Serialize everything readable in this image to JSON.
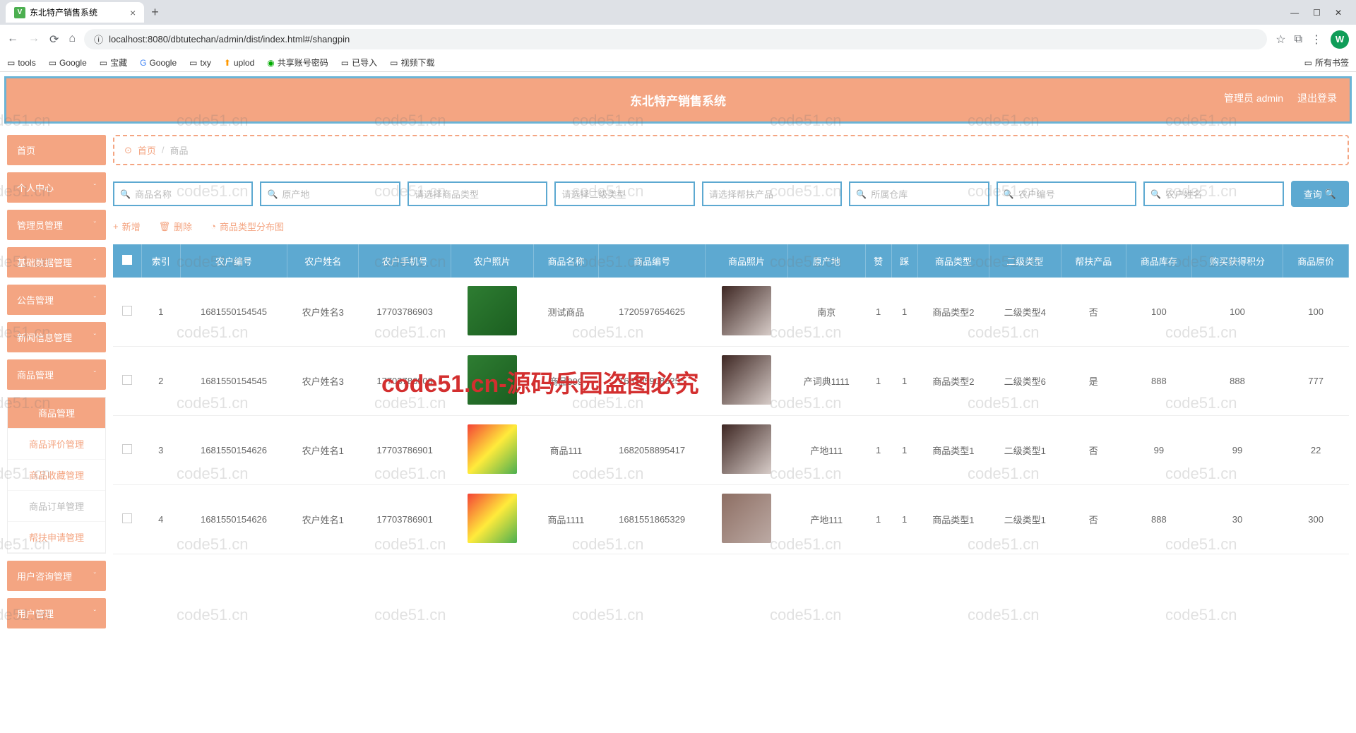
{
  "browser": {
    "tab_title": "东北特产销售系统",
    "url": "localhost:8080/dbtutechan/admin/dist/index.html#/shangpin",
    "bookmarks": [
      "tools",
      "Google",
      "宝藏",
      "Google",
      "txy",
      "uplod",
      "共享账号密码",
      "已导入",
      "视频下载"
    ],
    "bookmark_right": "所有书签",
    "avatar_letter": "W"
  },
  "header": {
    "title": "东北特产销售系统",
    "user": "管理员 admin",
    "logout": "退出登录"
  },
  "breadcrumb": {
    "home": "首页",
    "current": "商品"
  },
  "sidebar": {
    "items": [
      "首页",
      "个人中心",
      "管理员管理",
      "基础数据管理",
      "公告管理",
      "新闻信息管理",
      "商品管理"
    ],
    "sub": [
      "商品管理",
      "商品评价管理",
      "商品收藏管理",
      "商品订单管理",
      "帮扶申请管理"
    ],
    "items2": [
      "用户咨询管理",
      "用户管理"
    ]
  },
  "search": {
    "ph1": "商品名称",
    "ph2": "原产地",
    "ph3": "请选择商品类型",
    "ph4": "请选择二级类型",
    "ph5": "请选择帮扶产品",
    "ph6": "所属仓库",
    "ph7": "农户编号",
    "ph8": "农户姓名",
    "query": "查询"
  },
  "actions": {
    "add": "新增",
    "del": "删除",
    "chart": "商品类型分布图"
  },
  "table": {
    "headers": [
      "",
      "索引",
      "农户编号",
      "农户姓名",
      "农户手机号",
      "农户照片",
      "商品名称",
      "商品编号",
      "商品照片",
      "原产地",
      "赞",
      "踩",
      "商品类型",
      "二级类型",
      "帮扶产品",
      "商品库存",
      "购买获得积分",
      "商品原价"
    ],
    "rows": [
      {
        "idx": "1",
        "fno": "1681550154545",
        "fname": "农户姓名3",
        "fphone": "17703786903",
        "pname": "测试商品",
        "pno": "1720597654625",
        "origin": "南京",
        "like": "1",
        "dis": "1",
        "ptype": "商品类型2",
        "stype": "二级类型4",
        "help": "否",
        "stock": "100",
        "points": "100",
        "price": "100",
        "t1": "green",
        "t2": "person"
      },
      {
        "idx": "2",
        "fno": "1681550154545",
        "fname": "农户姓名3",
        "fphone": "17703786903",
        "pname": "商品999",
        "pno": "1682059086255",
        "origin": "产词典1111",
        "like": "1",
        "dis": "1",
        "ptype": "商品类型2",
        "stype": "二级类型6",
        "help": "是",
        "stock": "888",
        "points": "888",
        "price": "777",
        "t1": "green",
        "t2": "person"
      },
      {
        "idx": "3",
        "fno": "1681550154626",
        "fname": "农户姓名1",
        "fphone": "17703786901",
        "pname": "商品111",
        "pno": "1682058895417",
        "origin": "产地111",
        "like": "1",
        "dis": "1",
        "ptype": "商品类型1",
        "stype": "二级类型1",
        "help": "否",
        "stock": "99",
        "points": "99",
        "price": "22",
        "t1": "fruit",
        "t2": "person"
      },
      {
        "idx": "4",
        "fno": "1681550154626",
        "fname": "农户姓名1",
        "fphone": "17703786901",
        "pname": "商品1111",
        "pno": "1681551865329",
        "origin": "产地111",
        "like": "1",
        "dis": "1",
        "ptype": "商品类型1",
        "stype": "二级类型1",
        "help": "否",
        "stock": "888",
        "points": "30",
        "price": "300",
        "t1": "fruit",
        "t2": "art"
      }
    ]
  },
  "watermark": {
    "text": "code51.cn",
    "red": "code51.cn-源码乐园盗图必究"
  }
}
